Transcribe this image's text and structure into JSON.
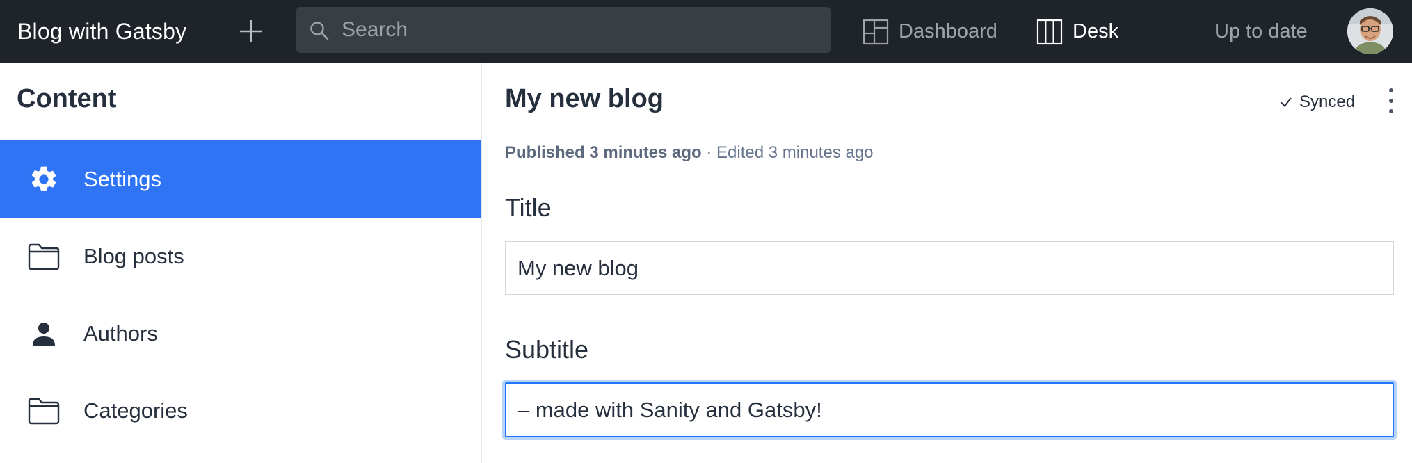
{
  "topbar": {
    "brand": "Blog with Gatsby",
    "create_icon": "plus-icon",
    "search": {
      "placeholder": "Search",
      "value": "",
      "icon": "search-icon"
    },
    "nav": [
      {
        "label": "Dashboard",
        "icon": "dashboard-icon",
        "active": false
      },
      {
        "label": "Desk",
        "icon": "desk-columns-icon",
        "active": true
      }
    ],
    "status": "Up to date",
    "avatar_icon": "user-avatar"
  },
  "sidebar": {
    "title": "Content",
    "items": [
      {
        "label": "Settings",
        "icon": "gear-icon",
        "active": true
      },
      {
        "label": "Blog posts",
        "icon": "folder-icon",
        "active": false
      },
      {
        "label": "Authors",
        "icon": "person-icon",
        "active": false
      },
      {
        "label": "Categories",
        "icon": "folder-icon",
        "active": false
      }
    ]
  },
  "document": {
    "title": "My new blog",
    "sync_status": "Synced",
    "published": "Published 3 minutes ago",
    "separator": " · ",
    "edited": "Edited 3 minutes ago",
    "fields": [
      {
        "label": "Title",
        "value": "My new blog",
        "focused": false
      },
      {
        "label": "Subtitle",
        "value": "– made with Sanity and Gatsby!",
        "focused": true
      }
    ]
  },
  "colors": {
    "topbar_bg": "#1f232a",
    "accent": "#2f74f5",
    "focus_border": "#2276fc"
  }
}
